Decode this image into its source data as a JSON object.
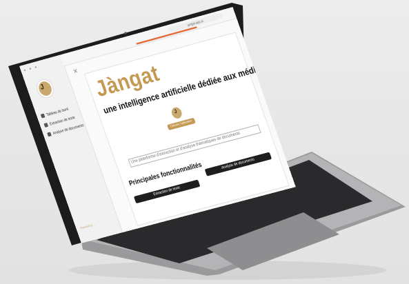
{
  "sidebar": {
    "items": [
      {
        "label": "Tableau de bord"
      },
      {
        "label": "Extraction de texte"
      },
      {
        "label": "Analyse de documents"
      }
    ],
    "footer": "Powered by ..."
  },
  "browser": {
    "url": "jangat.app.ai"
  },
  "main": {
    "title": "Jàngat",
    "subtitle": "une intelligence artificielle dédiée aux médias",
    "cta": "Débuter l'utilisation",
    "description": "Une plateforme d'extraction et d'analyse thématiques de documents",
    "section_title": "Principales fonctionnalités",
    "features": [
      "Extraction de texte",
      "Analyse de documents"
    ]
  },
  "colors": {
    "brand_gold": "#c49a52",
    "dark": "#1e1e1e",
    "laptop": "#2b2b2d"
  }
}
